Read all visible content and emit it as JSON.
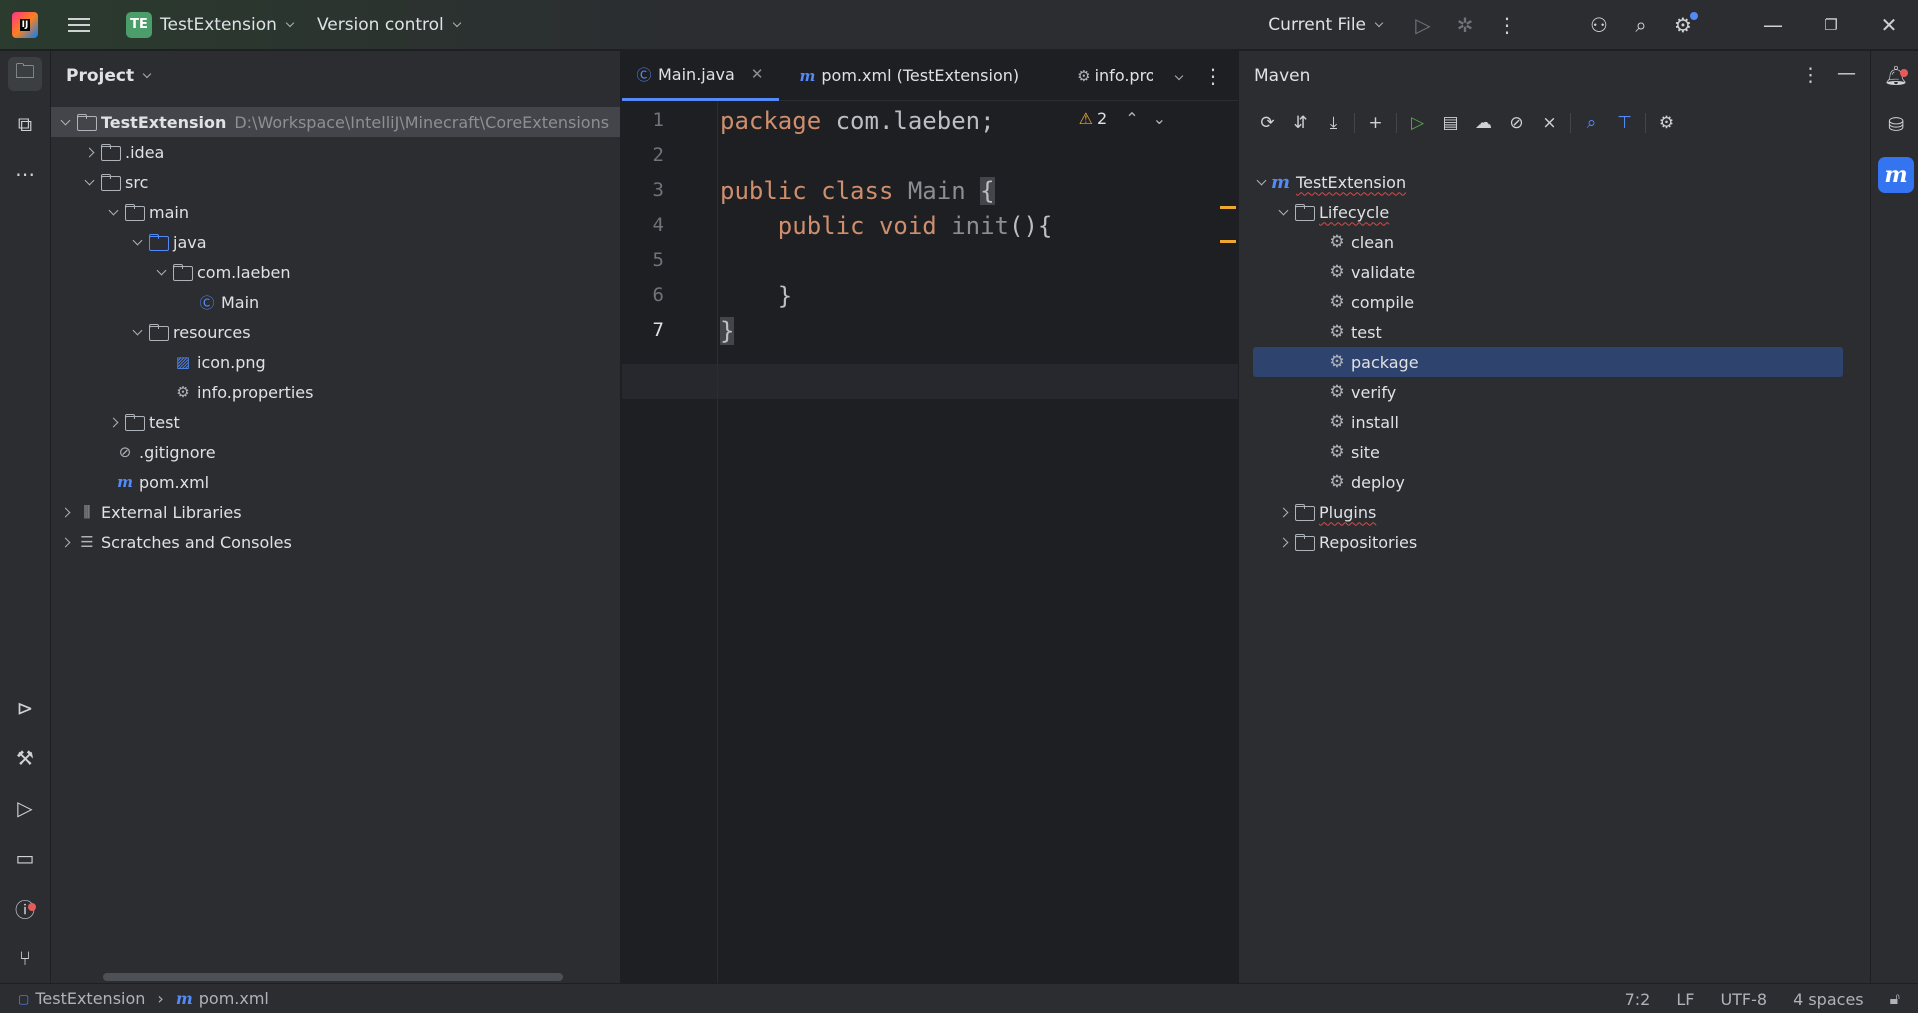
{
  "titlebar": {
    "project_badge": "TE",
    "project_name": "TestExtension",
    "vcs_label": "Version control",
    "run_config": "Current File"
  },
  "left_strip": [
    "folder-icon",
    "structure-icon",
    "more-icon",
    "services-icon",
    "build-icon",
    "run-icon",
    "terminal-icon",
    "problems-icon",
    "git-icon"
  ],
  "project": {
    "title": "Project",
    "root": {
      "name": "TestExtension",
      "path": "D:\\Workspace\\IntelliJ\\Minecraft\\CoreExtensions"
    },
    "items": [
      {
        "label": ".idea"
      },
      {
        "label": "src"
      },
      {
        "label": "main"
      },
      {
        "label": "java"
      },
      {
        "label": "com.laeben"
      },
      {
        "label": "Main"
      },
      {
        "label": "resources"
      },
      {
        "label": "icon.png"
      },
      {
        "label": "info.properties"
      },
      {
        "label": "test"
      },
      {
        "label": ".gitignore"
      },
      {
        "label": "pom.xml"
      },
      {
        "label": "External Libraries"
      },
      {
        "label": "Scratches and Consoles"
      }
    ]
  },
  "editor": {
    "tabs": [
      {
        "label": "Main.java"
      },
      {
        "label": "pom.xml (TestExtension)"
      },
      {
        "label": "info.prop"
      }
    ],
    "warnings": "2",
    "line_numbers": [
      "1",
      "2",
      "3",
      "4",
      "5",
      "6",
      "7"
    ],
    "code": {
      "l1_kw": "package",
      "l1_rest": " com.laeben;",
      "l3_kw": "public class",
      "l3_cls": " Main ",
      "l3_brace": "{",
      "l4_indent": "    ",
      "l4_kw": "public void",
      "l4_fn": " init",
      "l4_rest": "(){",
      "l6": "    }",
      "l7": "}"
    }
  },
  "maven": {
    "title": "Maven",
    "root": "TestExtension",
    "lifecycle": "Lifecycle",
    "goals": [
      "clean",
      "validate",
      "compile",
      "test",
      "package",
      "verify",
      "install",
      "site",
      "deploy"
    ],
    "selected": "package",
    "plugins": "Plugins",
    "repositories": "Repositories"
  },
  "statusbar": {
    "crumb_project": "TestExtension",
    "crumb_file": "pom.xml",
    "position": "7:2",
    "line_sep": "LF",
    "encoding": "UTF-8",
    "indent": "4 spaces"
  },
  "colors": {
    "accent": "#548af7",
    "selection": "#2e436e",
    "keyword": "#cf8e6d",
    "warning": "#f0a732"
  }
}
